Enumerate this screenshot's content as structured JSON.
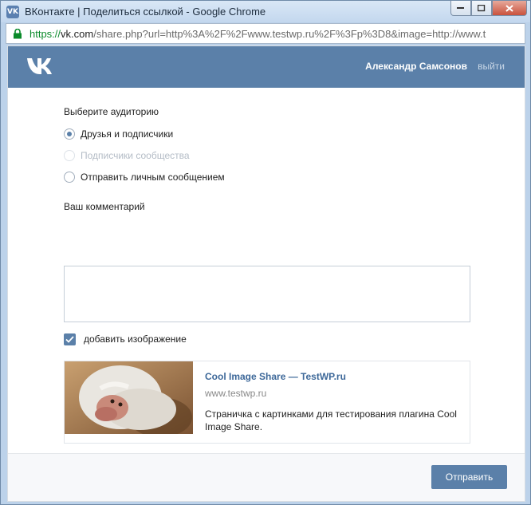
{
  "window": {
    "title": "ВКонтакте | Поделиться ссылкой - Google Chrome",
    "favicon": "vk-icon"
  },
  "addressbar": {
    "scheme": "https://",
    "host": "vk.com",
    "path": "/share.php?url=http%3A%2F%2Fwww.testwp.ru%2F%3Fp%3D8&image=http://www.t"
  },
  "header": {
    "user_name": "Александр Самсонов",
    "logout_label": "выйти"
  },
  "audience": {
    "label": "Выберите аудиторию",
    "options": [
      {
        "label": "Друзья и подписчики",
        "checked": true,
        "disabled": false
      },
      {
        "label": "Подписчики сообщества",
        "checked": false,
        "disabled": true
      },
      {
        "label": "Отправить личным сообщением",
        "checked": false,
        "disabled": false
      }
    ]
  },
  "comment": {
    "label": "Ваш комментарий",
    "value": ""
  },
  "add_image": {
    "label": "добавить изображение",
    "checked": true
  },
  "card": {
    "title": "Cool Image Share — TestWP.ru",
    "url": "www.testwp.ru",
    "description": "Страничка с картинками для тестирования плагина Cool Image Share."
  },
  "footer": {
    "send_label": "Отправить"
  },
  "colors": {
    "accent": "#5b80a9",
    "link": "#3d6899",
    "url_scheme": "#0a8a2a"
  }
}
